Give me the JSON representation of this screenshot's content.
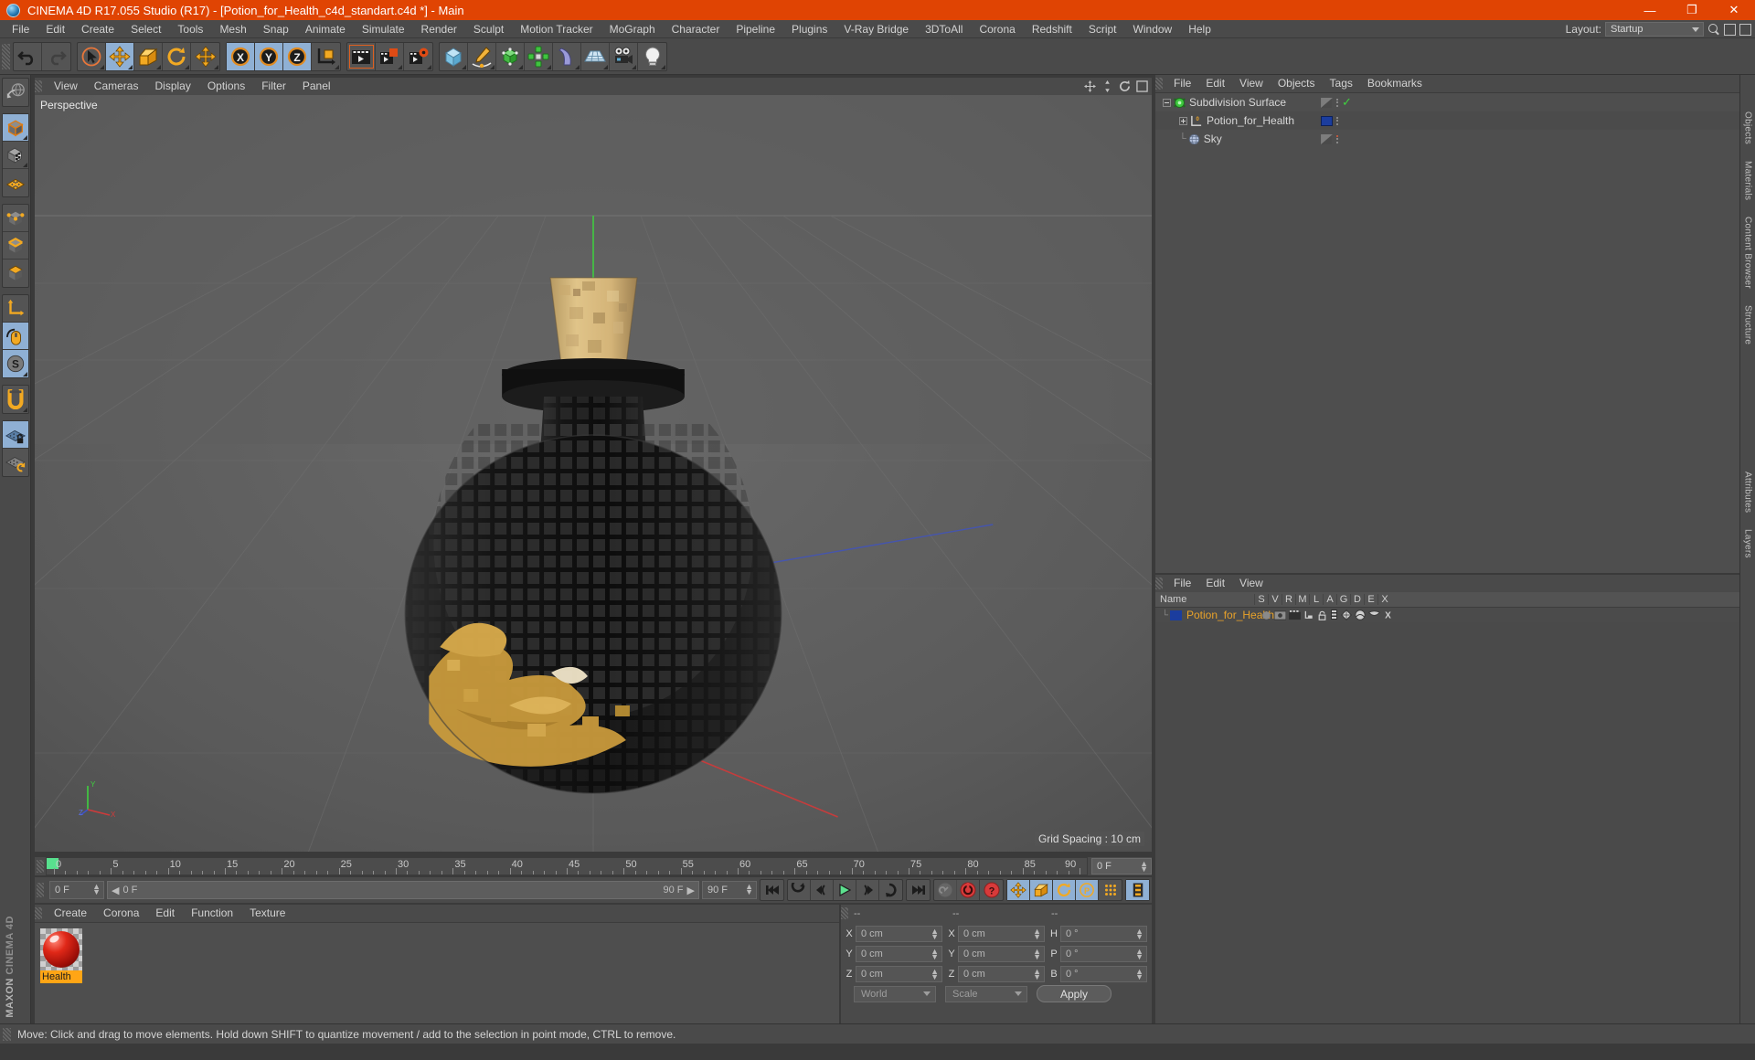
{
  "titlebar": {
    "title": "CINEMA 4D R17.055 Studio (R17) - [Potion_for_Health_c4d_standart.c4d *] - Main",
    "minimize": "—",
    "maximize": "❐",
    "close": "✕"
  },
  "menubar": {
    "items": [
      "File",
      "Edit",
      "Create",
      "Select",
      "Tools",
      "Mesh",
      "Snap",
      "Animate",
      "Simulate",
      "Render",
      "Sculpt",
      "Motion Tracker",
      "MoGraph",
      "Character",
      "Pipeline",
      "Plugins",
      "V-Ray Bridge",
      "3DToAll",
      "Corona",
      "Redshift",
      "Script",
      "Window",
      "Help"
    ],
    "layout_label": "Layout:",
    "layout_value": "Startup"
  },
  "toolbar": {
    "groups": [
      {
        "name": "history",
        "buttons": [
          {
            "name": "undo-icon",
            "label": "Undo"
          },
          {
            "name": "redo-icon",
            "label": "Redo"
          }
        ]
      },
      {
        "name": "transform",
        "buttons": [
          {
            "name": "select-cursor-icon",
            "label": "Live Selection"
          },
          {
            "name": "move-tool-icon",
            "label": "Move",
            "active": true
          },
          {
            "name": "scale-tool-icon",
            "label": "Scale"
          },
          {
            "name": "rotate-tool-icon",
            "label": "Rotate"
          },
          {
            "name": "move-world-icon",
            "label": "Move World"
          }
        ]
      },
      {
        "name": "axis-locks",
        "buttons": [
          {
            "name": "axis-x-icon",
            "label": "X",
            "active": true
          },
          {
            "name": "axis-y-icon",
            "label": "Y",
            "active": true
          },
          {
            "name": "axis-z-icon",
            "label": "Z",
            "active": true
          },
          {
            "name": "world-object-coord-icon",
            "label": "World/Object"
          }
        ]
      },
      {
        "name": "render",
        "buttons": [
          {
            "name": "render-view-icon",
            "label": "Render View"
          },
          {
            "name": "render-picture-viewer-icon",
            "label": "Render to Picture Viewer"
          },
          {
            "name": "render-settings-icon",
            "label": "Render Settings"
          }
        ]
      },
      {
        "name": "objects",
        "buttons": [
          {
            "name": "cube-primitive-icon",
            "label": "Cube"
          },
          {
            "name": "spline-pen-icon",
            "label": "Spline"
          },
          {
            "name": "generator-icon",
            "label": "Generators"
          },
          {
            "name": "mograph-icon",
            "label": "MoGraph"
          },
          {
            "name": "deformer-bend-icon",
            "label": "Deformer"
          },
          {
            "name": "floor-scene-icon",
            "label": "Scene"
          },
          {
            "name": "camera-icon",
            "label": "Camera"
          },
          {
            "name": "light-icon",
            "label": "Light"
          }
        ]
      }
    ]
  },
  "leftbar": {
    "groups": [
      [
        {
          "name": "undo-view-icon",
          "label": "Undo View"
        }
      ],
      [
        {
          "name": "model-mode-icon",
          "label": "Model Mode",
          "active": true
        },
        {
          "name": "texture-mode-icon",
          "label": "Texture Mode"
        },
        {
          "name": "polygon-axis-icon",
          "label": "Axis Mode"
        }
      ],
      [
        {
          "name": "point-mode-icon",
          "label": "Points"
        },
        {
          "name": "edge-mode-icon",
          "label": "Edges"
        },
        {
          "name": "polygon-mode-icon",
          "label": "Polygons"
        }
      ],
      [
        {
          "name": "object-axis-icon",
          "label": "Object Axis"
        },
        {
          "name": "viewport-solo-icon",
          "label": "Viewport Solo",
          "active": true
        },
        {
          "name": "workplane-icon",
          "label": "Workplane",
          "active": true
        }
      ],
      [
        {
          "name": "magnet-tool-icon",
          "label": "Magnet"
        }
      ],
      [
        {
          "name": "lock-workplane-icon",
          "label": "Lock Workplane",
          "active": true
        },
        {
          "name": "planar-workplane-icon",
          "label": "Planar Workplane"
        }
      ]
    ],
    "brand_line1": "MAXON",
    "brand_line2": "CINEMA 4D"
  },
  "viewport": {
    "menu": [
      "View",
      "Cameras",
      "Display",
      "Options",
      "Filter",
      "Panel"
    ],
    "perspective_label": "Perspective",
    "grid_spacing": "Grid Spacing : 10 cm",
    "axis_x": "X",
    "axis_y": "Y",
    "axis_z": "Z"
  },
  "timeline": {
    "ticks": [
      0,
      5,
      10,
      15,
      20,
      25,
      30,
      35,
      40,
      45,
      50,
      55,
      60,
      65,
      70,
      75,
      80,
      85,
      90
    ],
    "range_start": 0,
    "range_end": 90,
    "current_frame_field": "0 F",
    "start_field": "0 F",
    "range_left": "0 F",
    "range_right": "90 F",
    "end_field": "90 F",
    "transport": [
      {
        "name": "goto-start-button",
        "label": "Go to Start"
      },
      {
        "name": "step-back-keyframe-button",
        "label": "Previous Key"
      },
      {
        "name": "step-back-frame-button",
        "label": "Previous Frame"
      },
      {
        "name": "play-button",
        "label": "Play"
      },
      {
        "name": "step-forward-frame-button",
        "label": "Next Frame"
      },
      {
        "name": "step-forward-keyframe-button",
        "label": "Next Key"
      },
      {
        "name": "goto-end-button",
        "label": "Go to End"
      },
      {
        "name": "record-keyframe-button",
        "label": "Record Active Objects"
      },
      {
        "name": "autokeying-button",
        "label": "Autokeying"
      },
      {
        "name": "keyframe-selection-button",
        "label": "Keyframe Selection"
      },
      {
        "name": "position-key-button",
        "label": "Position",
        "active": true
      },
      {
        "name": "scale-key-button",
        "label": "Scale",
        "active": true
      },
      {
        "name": "rotation-key-button",
        "label": "Rotation",
        "active": true
      },
      {
        "name": "parameter-key-button",
        "label": "Parameter",
        "active": true
      },
      {
        "name": "pla-key-button",
        "label": "Point Level Animation"
      },
      {
        "name": "timeline-filmstrip-button",
        "label": "Timeline",
        "active": true
      }
    ]
  },
  "material_manager": {
    "menu": [
      "Create",
      "Corona",
      "Edit",
      "Function",
      "Texture"
    ],
    "materials": [
      {
        "name": "Health"
      }
    ]
  },
  "coordinates": {
    "headers": [
      "--",
      "--",
      "--"
    ],
    "rows": [
      {
        "pos_label": "X",
        "pos_value": "0 cm",
        "size_label": "X",
        "size_value": "0 cm",
        "rot_label": "H",
        "rot_value": "0 °"
      },
      {
        "pos_label": "Y",
        "pos_value": "0 cm",
        "size_label": "Y",
        "size_value": "0 cm",
        "rot_label": "P",
        "rot_value": "0 °"
      },
      {
        "pos_label": "Z",
        "pos_value": "0 cm",
        "size_label": "Z",
        "size_value": "0 cm",
        "rot_label": "B",
        "rot_value": "0 °"
      }
    ],
    "system": "World",
    "mode": "Scale",
    "apply": "Apply"
  },
  "object_manager": {
    "menu": [
      "File",
      "Edit",
      "View",
      "Objects",
      "Tags",
      "Bookmarks"
    ],
    "items": [
      {
        "label": "Subdivision Surface",
        "icon": "subdivision-surface-icon",
        "depth": 0,
        "tag": "checker",
        "check": true
      },
      {
        "label": "Potion_for_Health",
        "icon": "polygon-object-icon",
        "depth": 1,
        "tag": "blue"
      },
      {
        "label": "Sky",
        "icon": "sky-object-icon",
        "depth": 1,
        "tag": "checker",
        "dot": "red"
      }
    ]
  },
  "layer_manager": {
    "menu": [
      "File",
      "Edit",
      "View"
    ],
    "columns": [
      "Name",
      "S",
      "V",
      "R",
      "M",
      "L",
      "A",
      "G",
      "D",
      "E",
      "X"
    ],
    "rows": [
      {
        "label": "Potion_for_Health",
        "color": "#1b3d9e"
      }
    ]
  },
  "edge_tabs": [
    "Objects",
    "Materials",
    "Content Browser",
    "Structure",
    "Attributes",
    "Layers"
  ],
  "statusbar": {
    "message": "Move: Click and drag to move elements. Hold down SHIFT to quantize movement / add to the selection in point mode, CTRL to remove."
  },
  "colors": {
    "brand_orange": "#e04403",
    "accent_blue": "#8fb0d4",
    "panel_bg": "#4a4a4a",
    "material_highlight": "#ffa515"
  }
}
